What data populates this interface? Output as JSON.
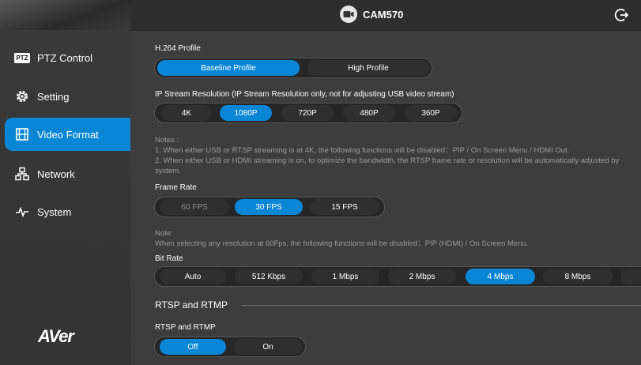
{
  "header": {
    "title": "CAM570"
  },
  "sidebar": {
    "items": [
      {
        "label": "PTZ Control",
        "badge": "PTZ",
        "icon": "ptz-icon"
      },
      {
        "label": "Setting",
        "icon": "gear-icon"
      },
      {
        "label": "Video Format",
        "icon": "film-icon"
      },
      {
        "label": "Network",
        "icon": "network-icon"
      },
      {
        "label": "System",
        "icon": "pulse-icon"
      }
    ],
    "logo": "AVer"
  },
  "h264": {
    "label": "H.264 Profile",
    "options": [
      "Baseline Profile",
      "High Profile"
    ],
    "selected": "Baseline Profile"
  },
  "resolution": {
    "label": "IP Stream Resolution (IP Stream Resolution only, not for adjusting USB video stream)",
    "options": [
      "4K",
      "1080P",
      "720P",
      "480P",
      "360P"
    ],
    "selected": "1080P"
  },
  "notes": {
    "title": "Notes :",
    "line1": "1. When either USB or RTSP streaming is at 4K, the following functions will be disabled：PIP / On Screen Menu / HDMI Out.",
    "line2": "2. When either USB or HDMI streaming is on, to optimize the bandwidth, the RTSP frame rate or resolution will be automatically adjusted by system."
  },
  "frame_rate": {
    "label": "Frame Rate",
    "options": [
      "60 FPS",
      "30 FPS",
      "15 FPS"
    ],
    "selected": "30 FPS",
    "disabled": [
      "60 FPS"
    ]
  },
  "note2": {
    "title": "Note:",
    "line": "When selecting any resolution at 60Fps, the following functions will be disabled：PIP (HDMI) / On Screen Menu."
  },
  "bit_rate": {
    "label": "Bit Rate",
    "options": [
      "Auto",
      "512 Kbps",
      "1 Mbps",
      "2 Mbps",
      "4 Mbps",
      "8 Mbps"
    ],
    "selected": "4 Mbps"
  },
  "rtsp": {
    "section_title": "RTSP and RTMP",
    "label": "RTSP and RTMP",
    "options": [
      "Off",
      "On"
    ],
    "selected": "Off"
  },
  "colors": {
    "accent": "#0a86d6",
    "background": "#3d3d3d",
    "sidebar": "#333333"
  }
}
